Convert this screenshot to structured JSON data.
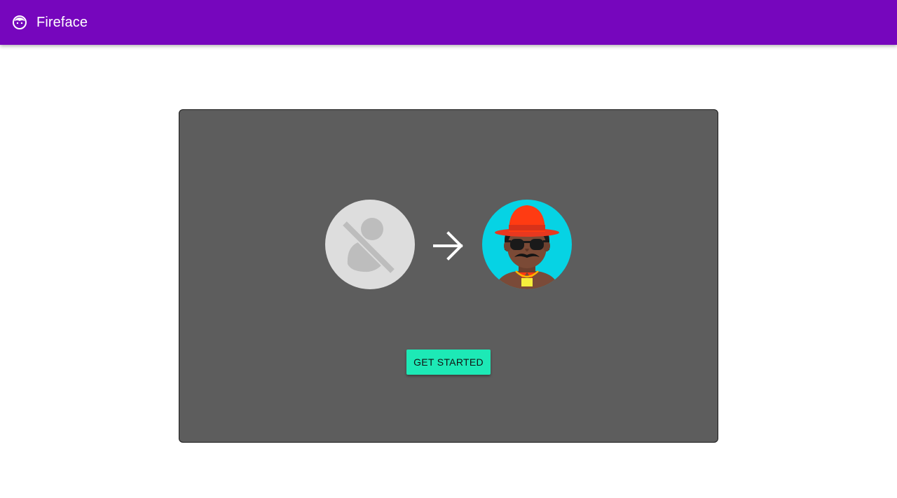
{
  "appbar": {
    "title": "Fireface",
    "logo_icon": "face-icon",
    "background": "#7606bd"
  },
  "card": {
    "background": "#5d5d5d",
    "left_avatar_icon": "no-face-icon",
    "arrow_icon": "arrow-right-icon",
    "right_avatar_icon": "emoji-face-avatar"
  },
  "cta": {
    "label": "GET STARTED",
    "color": "#1de9b6"
  }
}
